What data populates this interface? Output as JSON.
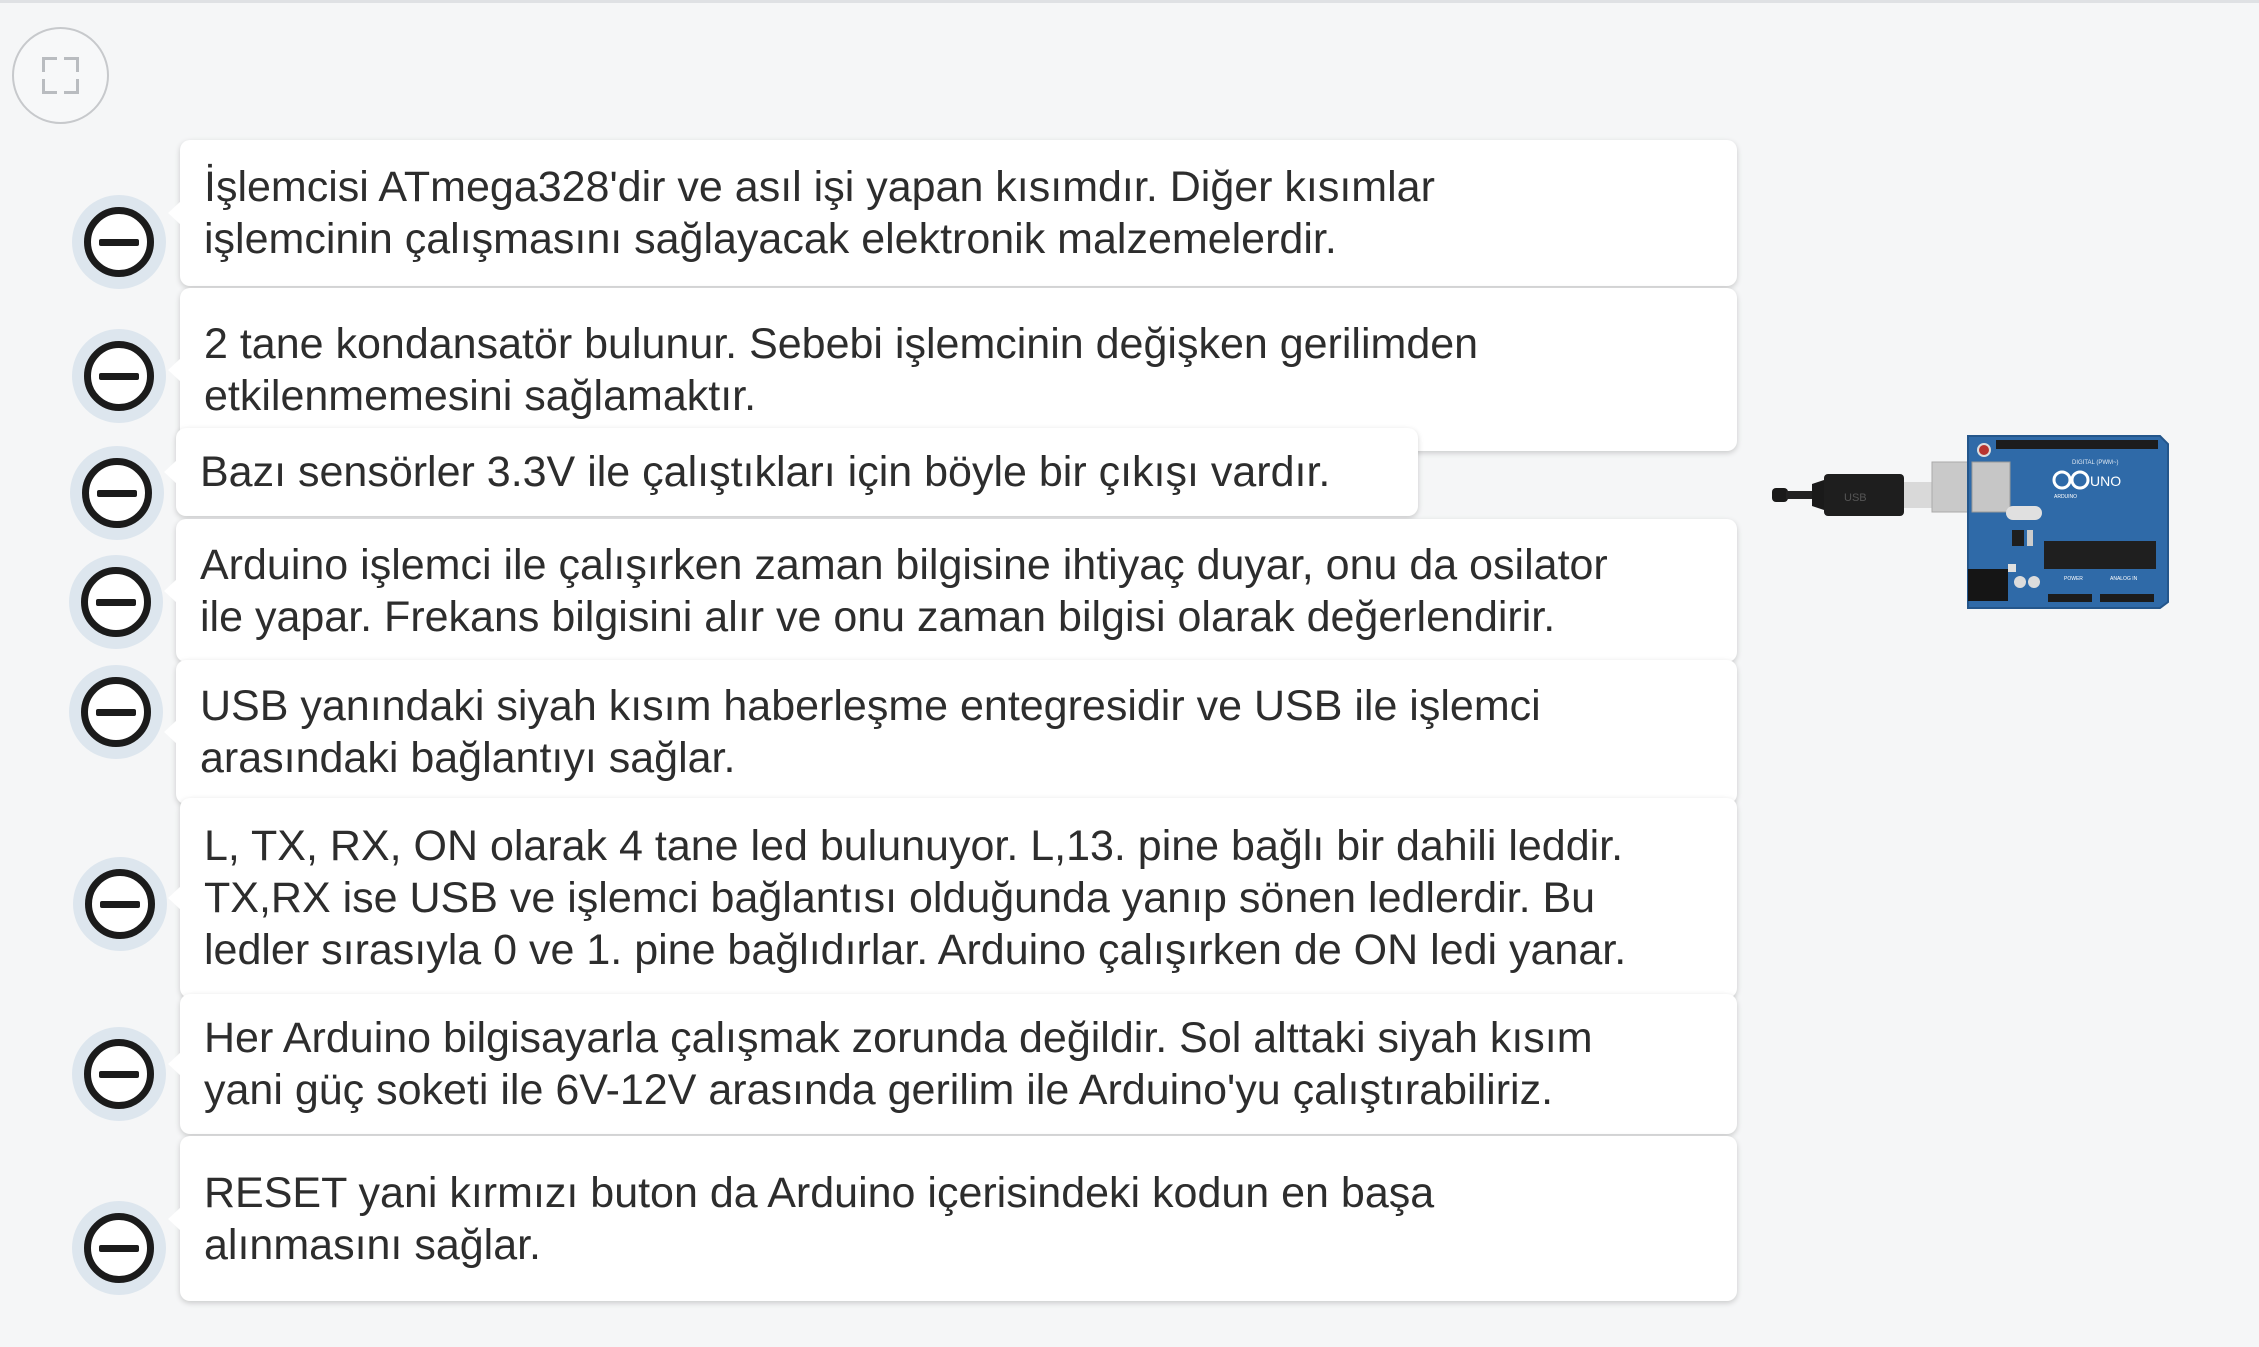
{
  "controls": {
    "fullscreen_icon": "fullscreen-icon"
  },
  "colors": {
    "board_blue": "#2f6aa8",
    "card_bg": "#ffffff",
    "hotspot_ring": "#1b1b1b",
    "hotspot_halo": "#dde6ee"
  },
  "cards": [
    {
      "text": "İşlemcisi ATmega328'dir ve asıl işi yapan kısımdır. Diğer kısımlar\nişlemcinin çalışmasını sağlayacak elektronik malzemelerdir."
    },
    {
      "text": "2 tane kondansatör bulunur. Sebebi işlemcinin değişken gerilimden\netkilenmemesini sağlamaktır."
    },
    {
      "text": "Bazı sensörler 3.3V ile çalıştıkları için böyle bir çıkışı vardır."
    },
    {
      "text": "Arduino işlemci ile çalışırken zaman bilgisine ihtiyaç duyar, onu da osilator\nile yapar. Frekans bilgisini alır ve onu zaman bilgisi olarak değerlendirir."
    },
    {
      "text": "USB yanındaki siyah kısım haberleşme entegresidir ve USB ile işlemci\narasındaki bağlantıyı sağlar."
    },
    {
      "text": "L, TX, RX, ON olarak 4 tane led bulunuyor. L,13. pine bağlı bir dahili leddir.\nTX,RX ise USB ve işlemci bağlantısı olduğunda yanıp sönen ledlerdir. Bu\nledler sırasıyla 0 ve 1. pine bağlıdırlar. Arduino çalışırken de ON ledi yanar."
    },
    {
      "text": "Her Arduino bilgisayarla çalışmak zorunda değildir. Sol alttaki siyah kısım\nyani güç soketi ile 6V-12V arasında gerilim ile Arduino'yu çalıştırabiliriz."
    },
    {
      "text": "RESET yani kırmızı buton da Arduino içerisindeki kodun en başa\nalınmasını sağlar."
    }
  ],
  "board": {
    "model_label": "UNO",
    "brand_label": "ARDUINO",
    "digital_label": "DIGITAL (PWM~)",
    "power_label": "POWER",
    "analog_label": "ANALOG IN",
    "usb_cable_label": "USB"
  }
}
